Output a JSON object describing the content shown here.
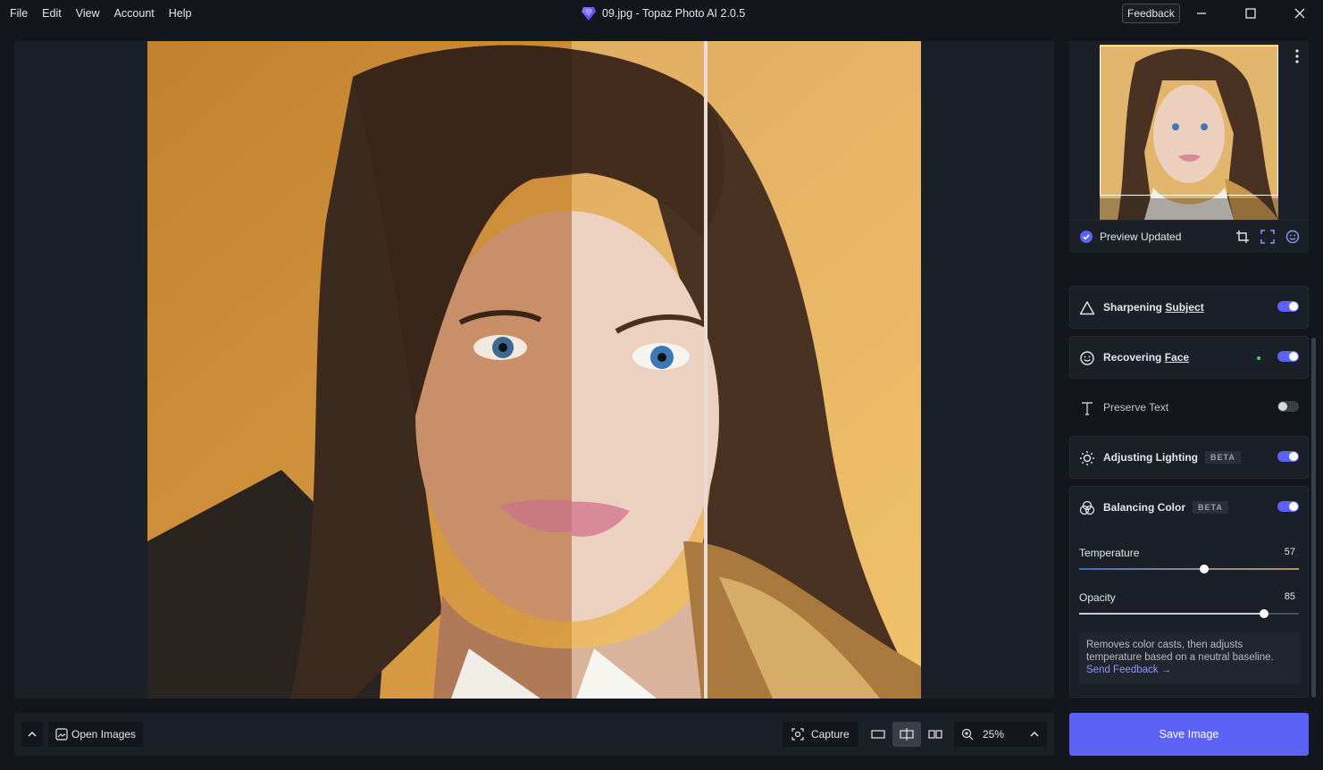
{
  "menu": [
    "File",
    "Edit",
    "View",
    "Account",
    "Help"
  ],
  "window": {
    "title": "09.jpg - Topaz Photo AI 2.0.5",
    "feedback_label": "Feedback"
  },
  "preview": {
    "status": "Preview Updated"
  },
  "filters": [
    {
      "label": "Sharpening",
      "link": "Subject",
      "enabled": true,
      "icon": "triangle-icon"
    },
    {
      "label": "Recovering",
      "link": "Face",
      "enabled": true,
      "icon": "face-icon"
    },
    {
      "label": "Preserve Text",
      "enabled": false,
      "icon": "text-icon"
    },
    {
      "label": "Adjusting Lighting",
      "badge": "BETA",
      "enabled": true,
      "icon": "sun-icon"
    },
    {
      "label": "Balancing Color",
      "badge": "BETA",
      "enabled": true,
      "icon": "color-balance-icon"
    }
  ],
  "balancing_color": {
    "temperature": {
      "label": "Temperature",
      "value": "57"
    },
    "opacity": {
      "label": "Opacity",
      "value": "85"
    },
    "description": "Removes color casts, then adjusts temperature based on a neutral baseline.",
    "feedback_link": "Send Feedback →"
  },
  "bottom": {
    "open_images": "Open Images",
    "capture": "Capture",
    "zoom": "25%",
    "save": "Save Image"
  },
  "colors": {
    "accent": "#5b62f5",
    "background": "#13161d",
    "panel": "#1b1f28"
  }
}
